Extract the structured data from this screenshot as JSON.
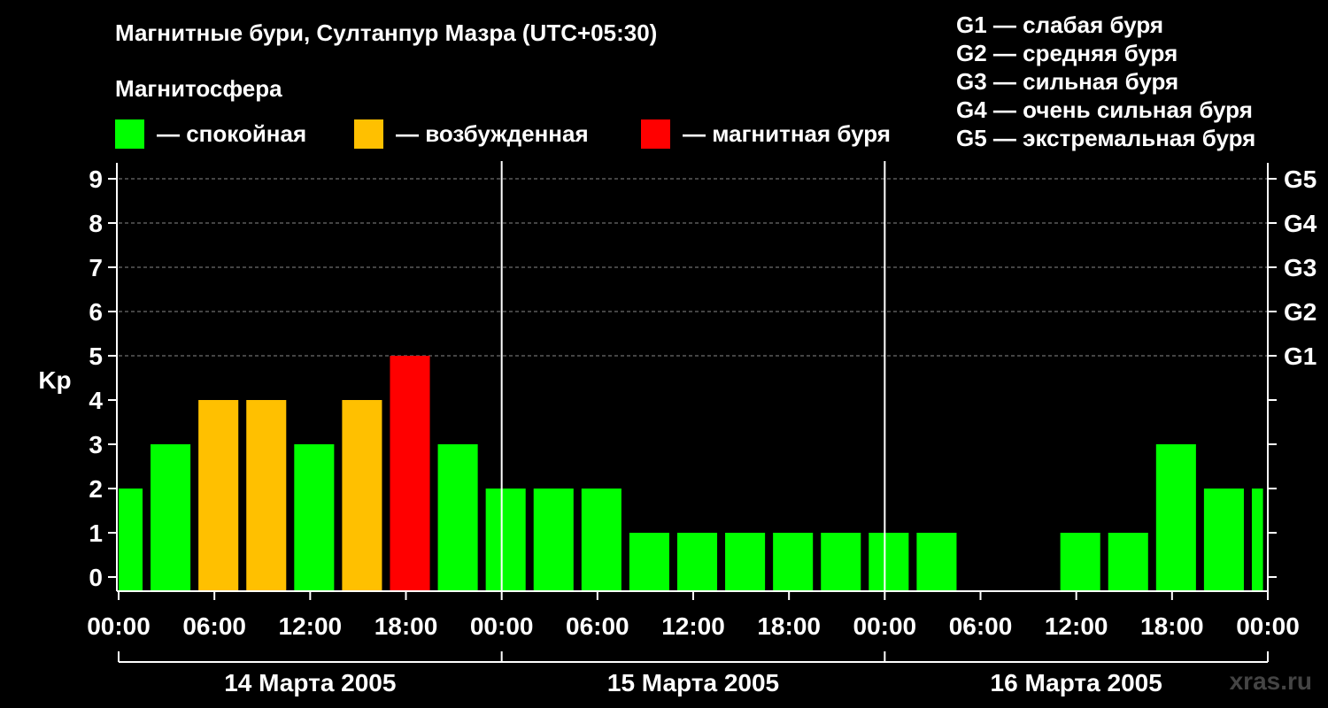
{
  "chart_data": {
    "type": "bar",
    "title": "Магнитные бури, Султанпур Мазра (UTC+05:30)",
    "subtitle": "Магнитосфера",
    "ylabel": "Kp",
    "xlabel": "",
    "ylim": [
      0,
      9
    ],
    "y_ticks": [
      "0",
      "1",
      "2",
      "3",
      "4",
      "5",
      "6",
      "7",
      "8",
      "9"
    ],
    "right_ticks": [
      {
        "kp": 5,
        "label": "G1"
      },
      {
        "kp": 6,
        "label": "G2"
      },
      {
        "kp": 7,
        "label": "G3"
      },
      {
        "kp": 8,
        "label": "G4"
      },
      {
        "kp": 9,
        "label": "G5"
      }
    ],
    "x_tick_labels": [
      "00:00",
      "06:00",
      "12:00",
      "18:00",
      "00:00",
      "06:00",
      "12:00",
      "18:00",
      "00:00",
      "06:00",
      "12:00",
      "18:00",
      "00:00"
    ],
    "x_tick_hours": [
      0,
      6,
      12,
      18,
      24,
      30,
      36,
      42,
      48,
      54,
      60,
      66,
      72
    ],
    "day_separators_hours": [
      24,
      48
    ],
    "days": [
      {
        "label": "14 Марта 2005",
        "start_hour": 0,
        "end_hour": 24
      },
      {
        "label": "15 Марта 2005",
        "start_hour": 24,
        "end_hour": 48
      },
      {
        "label": "16 Марта 2005",
        "start_hour": 48,
        "end_hour": 72
      }
    ],
    "grid": true,
    "levels": {
      "quiet": {
        "label": "— спокойная",
        "color": "#00ff00"
      },
      "disturbed": {
        "label": "— возбужденная",
        "color": "#ffc000"
      },
      "storm": {
        "label": "— магнитная буря",
        "color": "#ff0000"
      }
    },
    "bars": [
      {
        "start_hour": 0,
        "end_hour": 1.5,
        "kp": 2,
        "level": "quiet"
      },
      {
        "start_hour": 2,
        "end_hour": 4.5,
        "kp": 3,
        "level": "quiet"
      },
      {
        "start_hour": 5,
        "end_hour": 7.5,
        "kp": 4,
        "level": "disturbed"
      },
      {
        "start_hour": 8,
        "end_hour": 10.5,
        "kp": 4,
        "level": "disturbed"
      },
      {
        "start_hour": 11,
        "end_hour": 13.5,
        "kp": 3,
        "level": "quiet"
      },
      {
        "start_hour": 14,
        "end_hour": 16.5,
        "kp": 4,
        "level": "disturbed"
      },
      {
        "start_hour": 17,
        "end_hour": 19.5,
        "kp": 5,
        "level": "storm"
      },
      {
        "start_hour": 20,
        "end_hour": 22.5,
        "kp": 3,
        "level": "quiet"
      },
      {
        "start_hour": 23,
        "end_hour": 25.5,
        "kp": 2,
        "level": "quiet"
      },
      {
        "start_hour": 26,
        "end_hour": 28.5,
        "kp": 2,
        "level": "quiet"
      },
      {
        "start_hour": 29,
        "end_hour": 31.5,
        "kp": 2,
        "level": "quiet"
      },
      {
        "start_hour": 32,
        "end_hour": 34.5,
        "kp": 1,
        "level": "quiet"
      },
      {
        "start_hour": 35,
        "end_hour": 37.5,
        "kp": 1,
        "level": "quiet"
      },
      {
        "start_hour": 38,
        "end_hour": 40.5,
        "kp": 1,
        "level": "quiet"
      },
      {
        "start_hour": 41,
        "end_hour": 43.5,
        "kp": 1,
        "level": "quiet"
      },
      {
        "start_hour": 44,
        "end_hour": 46.5,
        "kp": 1,
        "level": "quiet"
      },
      {
        "start_hour": 47,
        "end_hour": 49.5,
        "kp": 1,
        "level": "quiet"
      },
      {
        "start_hour": 50,
        "end_hour": 52.5,
        "kp": 1,
        "level": "quiet"
      },
      {
        "start_hour": 59,
        "end_hour": 61.5,
        "kp": 1,
        "level": "quiet"
      },
      {
        "start_hour": 62,
        "end_hour": 64.5,
        "kp": 1,
        "level": "quiet"
      },
      {
        "start_hour": 65,
        "end_hour": 67.5,
        "kp": 3,
        "level": "quiet"
      },
      {
        "start_hour": 68,
        "end_hour": 70.5,
        "kp": 2,
        "level": "quiet"
      },
      {
        "start_hour": 71,
        "end_hour": 71.7,
        "kp": 2,
        "level": "quiet"
      }
    ]
  },
  "g_scale": [
    "G1 — слабая буря",
    "G2 — средняя буря",
    "G3 — сильная буря",
    "G4 — очень сильная буря",
    "G5 — экстремальная буря"
  ],
  "watermark": "xras.ru",
  "colors": {
    "background": "#000000",
    "foreground": "#ffffff",
    "grid": "#888888"
  }
}
